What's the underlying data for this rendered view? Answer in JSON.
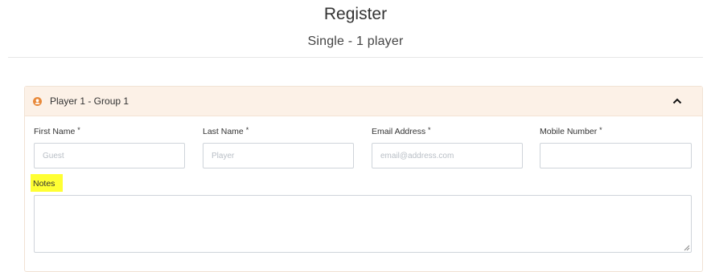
{
  "header": {
    "title": "Register",
    "subtitle": "Single - 1 player"
  },
  "player_panel": {
    "title": "Player 1 - Group 1",
    "icon": "user-circle-icon",
    "collapse_icon": "chevron-up-icon",
    "accent_color": "#e8893a",
    "header_bg": "#fcf1e7"
  },
  "form": {
    "first_name": {
      "label": "First Name",
      "required_mark": "*",
      "placeholder": "Guest",
      "value": ""
    },
    "last_name": {
      "label": "Last Name",
      "required_mark": "*",
      "placeholder": "Player",
      "value": ""
    },
    "email": {
      "label": "Email Address",
      "required_mark": "*",
      "placeholder": "email@address.com",
      "value": ""
    },
    "mobile": {
      "label": "Mobile Number",
      "required_mark": "*",
      "placeholder": "",
      "value": ""
    },
    "notes": {
      "label": "Notes",
      "value": "",
      "highlight_color": "#ffff33"
    }
  }
}
